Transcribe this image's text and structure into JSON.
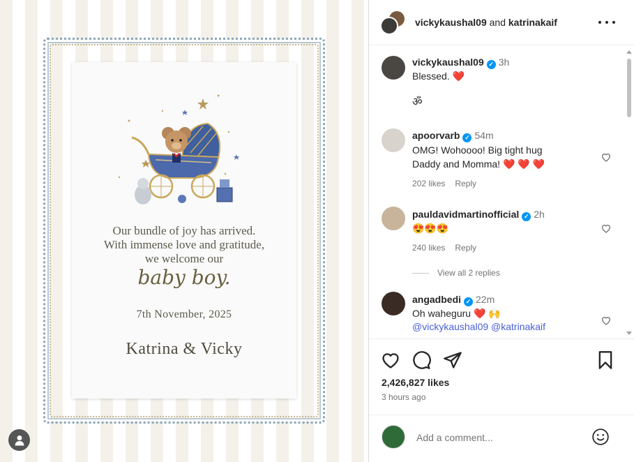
{
  "post": {
    "card": {
      "message_lines": [
        "Our bundle of joy has arrived.",
        "With immense love and gratitude,",
        "we welcome our"
      ],
      "script_text": "baby boy.",
      "date": "7th November, 2025",
      "names": "Katrina & Vicky"
    }
  },
  "header": {
    "user1": "vickykaushal09",
    "and_text": "and",
    "user2": "katrinakaif",
    "more_label": "..."
  },
  "comments": [
    {
      "user": "vickykaushal09",
      "time": "3h",
      "text": "Blessed. ❤️",
      "extra": "ॐ"
    },
    {
      "user": "apoorvarb",
      "time": "54m",
      "text_line1": "OMG! Wohoooo! Big tight hug",
      "text_line2": "Daddy and Momma! ❤️ ❤️ ❤️",
      "likes": "202 likes",
      "reply": "Reply"
    },
    {
      "user": "pauldavidmartinofficial",
      "time": "2h",
      "text": "😍😍😍",
      "likes": "240 likes",
      "reply": "Reply",
      "view_replies": "View all 2 replies"
    },
    {
      "user": "angadbedi",
      "time": "22m",
      "text": "Oh waheguru ❤️ 🙌",
      "mentions": "@vickykaushal09 @katrinakaif"
    }
  ],
  "actions": {
    "likes": "2,426,827 likes",
    "time_ago": "3 hours ago"
  },
  "add_comment": {
    "placeholder": "Add a comment..."
  },
  "colors": {
    "verified": "#0095f6",
    "heart": "#ed1c24",
    "mention": "#4a5fd6"
  }
}
